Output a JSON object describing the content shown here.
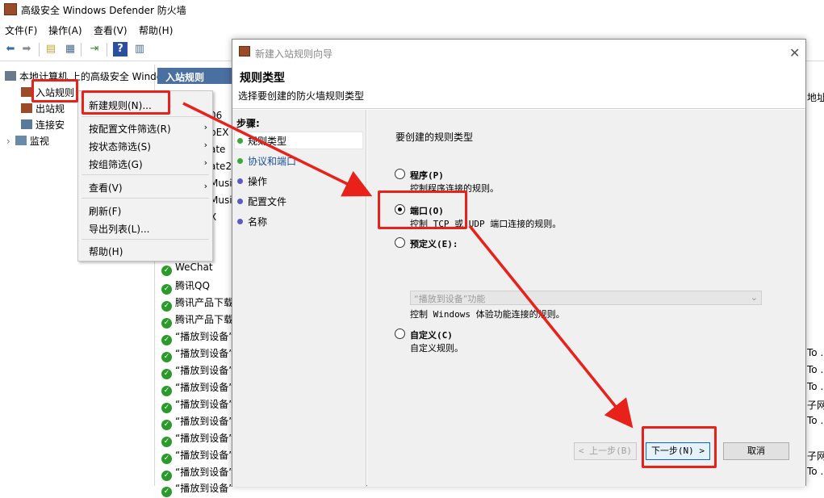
{
  "window": {
    "title": "高级安全 Windows Defender 防火墙",
    "app_icon": "firewall-icon"
  },
  "menubar": [
    "文件(F)",
    "操作(A)",
    "查看(V)",
    "帮助(H)"
  ],
  "toolbar": [
    "back-arrow-icon",
    "forward-arrow-icon",
    "folder-up-icon",
    "show-hide-tree-icon",
    "export-list-icon",
    "help-icon",
    "properties-icon"
  ],
  "tree": {
    "root": "本地计算机 上的高级安全 Windo",
    "items": [
      {
        "label": "入站规则",
        "icon": "inbound-rules-icon"
      },
      {
        "label": "出站规",
        "icon": "outbound-rules-icon"
      },
      {
        "label": "连接安",
        "icon": "connection-security-icon"
      },
      {
        "label": "监视",
        "icon": "monitor-icon"
      }
    ]
  },
  "rules_panel": {
    "header": "入站规则",
    "partial_rows": [
      "06",
      "pEX",
      "ate",
      "ate2",
      "Musi",
      "Musi",
      "X"
    ],
    "rows": [
      "WeChat",
      "腾讯QQ",
      "腾讯产品下载",
      "腾讯产品下载",
      "“播放到设备”",
      "“播放到设备”",
      "“播放到设备”",
      "“播放到设备”",
      "“播放到设备”",
      "“播放到设备”",
      "“播放到设备”",
      "“播放到设备”",
      "“播放到设备”",
      "“播放到设备”"
    ],
    "right_column": [
      "地址",
      "To .",
      "To .",
      "To .",
      "子网",
      "To .",
      "子网",
      "To ."
    ]
  },
  "context_menu": {
    "items": [
      {
        "label": "新建规则(N)...",
        "submenu": false
      },
      {
        "label": "按配置文件筛选(R)",
        "submenu": true
      },
      {
        "label": "按状态筛选(S)",
        "submenu": true
      },
      {
        "label": "按组筛选(G)",
        "submenu": true
      },
      {
        "label": "查看(V)",
        "submenu": true
      },
      {
        "label": "刷新(F)",
        "submenu": false
      },
      {
        "label": "导出列表(L)...",
        "submenu": false
      },
      {
        "label": "帮助(H)",
        "submenu": false
      }
    ]
  },
  "wizard": {
    "title": "新建入站规则向导",
    "heading": "规则类型",
    "subheading": "选择要创建的防火墙规则类型",
    "steps_label": "步骤:",
    "steps": [
      "规则类型",
      "协议和端口",
      "操作",
      "配置文件",
      "名称"
    ],
    "prompt": "要创建的规则类型",
    "options": [
      {
        "label": "程序(P)",
        "desc": "控制程序连接的规则。",
        "selected": false
      },
      {
        "label": "端口(O)",
        "desc": "控制 TCP 或 UDP 端口连接的规则。",
        "selected": true
      },
      {
        "label": "预定义(E):",
        "desc": "控制 Windows 体验功能连接的规则。",
        "selected": false
      },
      {
        "label": "自定义(C)",
        "desc": "自定义规则。",
        "selected": false
      }
    ],
    "predefined_value": "“播放到设备”功能",
    "buttons": {
      "back": "< 上一步(B)",
      "next": "下一步(N) >",
      "cancel": "取消"
    }
  },
  "colors": {
    "annotation_red": "#e8221b",
    "header_blue": "#4a6fa1",
    "rule_enabled_green": "#2a9a2a",
    "step_done_green": "#3aa83a",
    "step_pending_blue": "#5a5ac8"
  }
}
